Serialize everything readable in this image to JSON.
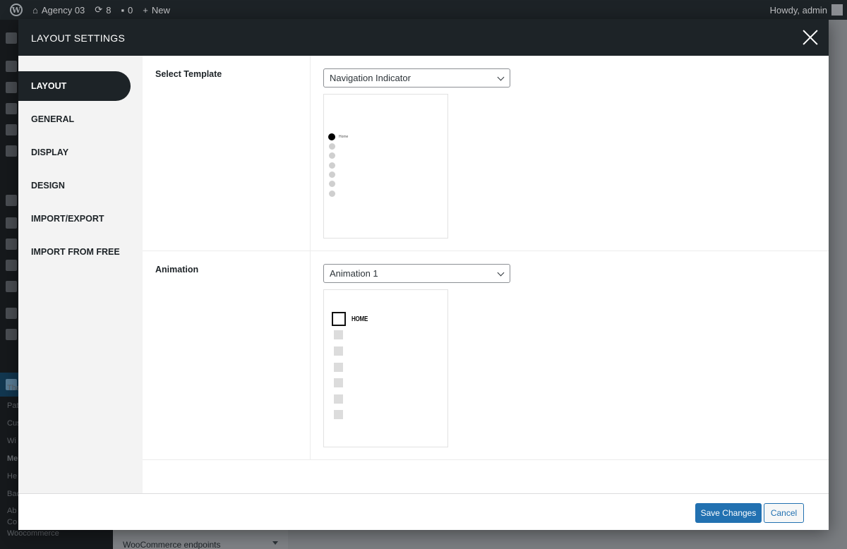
{
  "adminbar": {
    "site_name": "Agency 03",
    "updates_count": "8",
    "comments_count": "0",
    "new_label": "New",
    "greeting": "Howdy, admin"
  },
  "background": {
    "sidebar_submenu": [
      "The",
      "Pat",
      "Cus",
      "Wi",
      "Me",
      "He",
      "Bac",
      "Ab",
      "Co",
      "Woocommerce"
    ],
    "panel_title": "WooCommerce endpoints"
  },
  "modal": {
    "title": "LAYOUT SETTINGS",
    "tabs": [
      {
        "label": "LAYOUT",
        "active": true
      },
      {
        "label": "GENERAL",
        "active": false
      },
      {
        "label": "DISPLAY",
        "active": false
      },
      {
        "label": "DESIGN",
        "active": false
      },
      {
        "label": "IMPORT/EXPORT",
        "active": false
      },
      {
        "label": "IMPORT FROM FREE",
        "active": false
      }
    ],
    "template": {
      "label": "Select Template",
      "selected": "Navigation Indicator",
      "preview_first_item": "Home"
    },
    "animation": {
      "label": "Animation",
      "selected": "Animation 1",
      "preview_first_item": "HOME"
    },
    "footer": {
      "save_label": "Save Changes",
      "cancel_label": "Cancel"
    }
  },
  "colors": {
    "header_bg": "#1d2327",
    "primary": "#2271b1",
    "tab_bg": "#f3f3f3"
  }
}
